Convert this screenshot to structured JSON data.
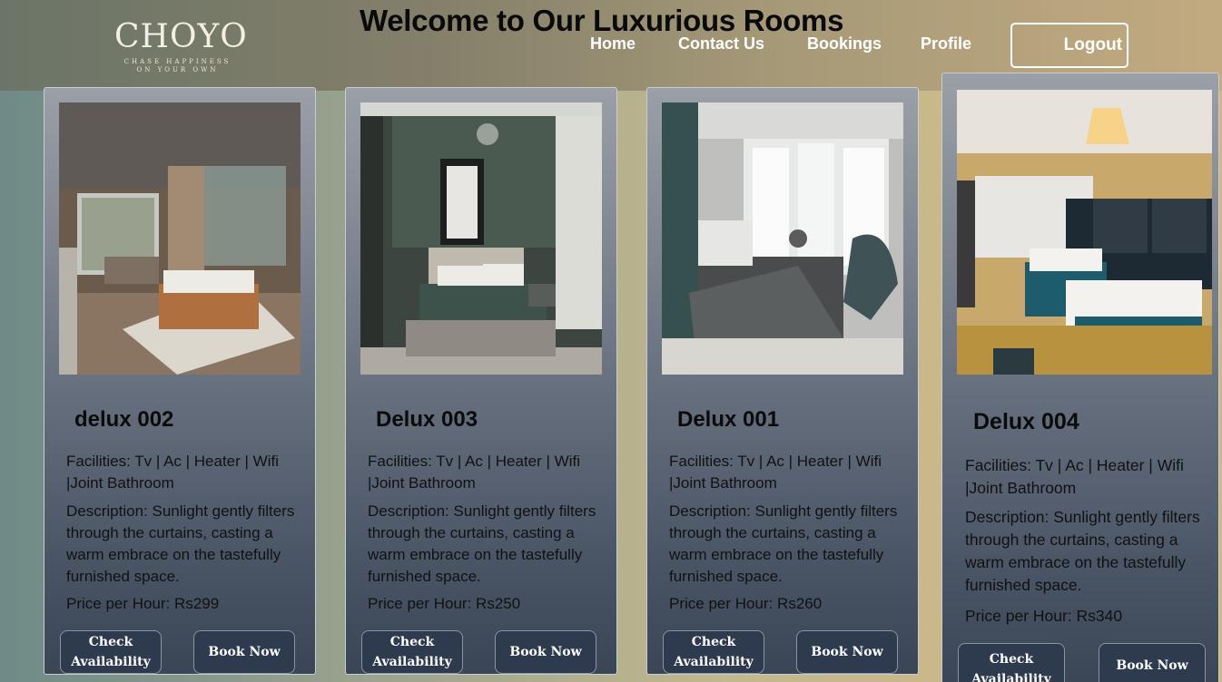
{
  "header": {
    "logo_text": "CHOYO",
    "logo_tagline_1": "CHASE HAPPINESS",
    "logo_tagline_2": "ON YOUR OWN",
    "title": "Welcome to Our Luxurious Rooms",
    "nav": [
      "Home",
      "Contact Us",
      "Bookings",
      "Profile"
    ],
    "logout": "Logout"
  },
  "rooms": [
    {
      "name": "delux 002",
      "facilities": "Facilities: Tv | Ac | Heater | Wifi |Joint Bathroom",
      "description": "Description: Sunlight gently filters through the curtains, casting a warm embrace on the tastefully furnished space.",
      "price": "Price per Hour: Rs299",
      "check_label": "Check Availability",
      "book_label": "Book Now"
    },
    {
      "name": "Delux 003",
      "facilities": "Facilities: Tv | Ac | Heater | Wifi |Joint Bathroom",
      "description": "Description: Sunlight gently filters through the curtains, casting a warm embrace on the tastefully furnished space.",
      "price": "Price per Hour: Rs250",
      "check_label": "Check Availability",
      "book_label": "Book Now"
    },
    {
      "name": "Delux 001",
      "facilities": "Facilities: Tv | Ac | Heater | Wifi |Joint Bathroom",
      "description": "Description: Sunlight gently filters through the curtains, casting a warm embrace on the tastefully furnished space.",
      "price": "Price per Hour: Rs260",
      "check_label": "Check Availability",
      "book_label": "Book Now"
    },
    {
      "name": "Delux 004",
      "facilities": "Facilities: Tv | Ac | Heater | Wifi |Joint Bathroom",
      "description": "Description: Sunlight gently filters through the curtains, casting a warm embrace on the tastefully furnished space.",
      "price": "Price per Hour: Rs340",
      "check_label": "Check Availability",
      "book_label": "Book Now"
    }
  ]
}
